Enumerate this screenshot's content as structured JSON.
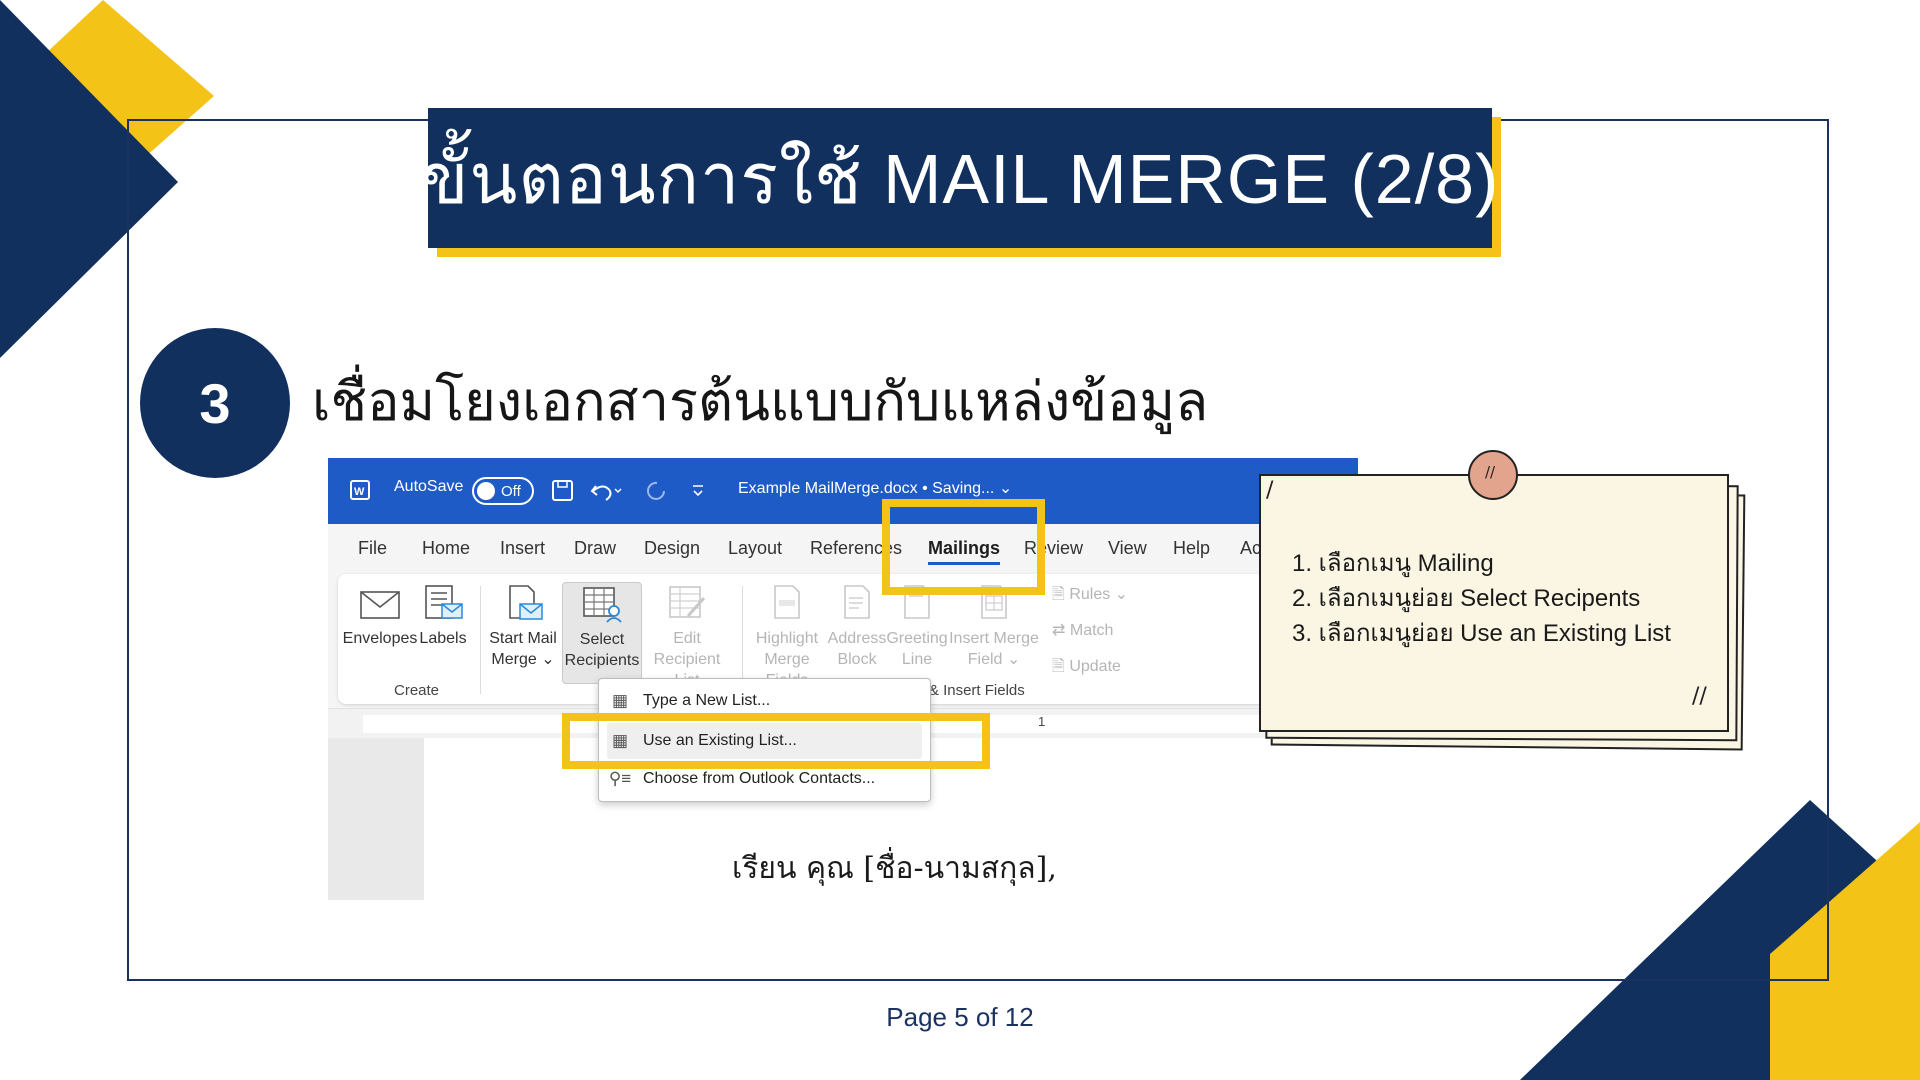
{
  "slide": {
    "title": "ขั้นตอนการใช้ MAIL MERGE (2/8)",
    "step_number": "3",
    "step_heading": "เชื่อมโยงเอกสารต้นแบบกับแหล่งข้อมูล",
    "page_indicator": "Page 5 of 12"
  },
  "colors": {
    "navy": "#12305e",
    "yellow": "#f3c317",
    "word_blue": "#1f5bc6",
    "note_bg": "#fbf6e4",
    "pin": "#e3a48d"
  },
  "word": {
    "titlebar": {
      "autosave_label": "AutoSave",
      "autosave_state": "Off",
      "doc_title": "Example MailMerge.docx • Saving... ⌄"
    },
    "tabs": [
      "File",
      "Home",
      "Insert",
      "Draw",
      "Design",
      "Layout",
      "References",
      "Mailings",
      "Review",
      "View",
      "Help",
      "Ac"
    ],
    "active_tab": "Mailings",
    "ribbon": {
      "envelopes": "Envelopes",
      "labels": "Labels",
      "start_mail_merge": [
        "Start Mail",
        "Merge ⌄"
      ],
      "select_recipients": [
        "Select",
        "Recipients ⌄"
      ],
      "edit_recipient_list": [
        "Edit",
        "Recipient List"
      ],
      "highlight_merge_fields": [
        "Highlight",
        "Merge Fields"
      ],
      "address_block": [
        "Address",
        "Block"
      ],
      "greeting_line": [
        "Greeting",
        "Line"
      ],
      "insert_merge_field": [
        "Insert Merge",
        "Field ⌄"
      ],
      "rules": "Rules ⌄",
      "match": "Match",
      "update": "Update",
      "group_create": "Create",
      "group_write_insert": "Write & Insert Fields"
    },
    "dropdown": [
      {
        "label": "Type a New List...",
        "icon": "table-icon"
      },
      {
        "label": "Use an Existing List...",
        "icon": "table-icon"
      },
      {
        "label": "Choose from Outlook Contacts...",
        "icon": "contacts-icon"
      }
    ],
    "ruler_mark": "1",
    "document_text": "เรียน คุณ [ชื่อ-นามสกุล],"
  },
  "note": {
    "items": [
      "1. เลือกเมนู Mailing",
      "2. เลือกเมนูย่อย Select Recipents",
      "3. เลือกเมนูย่อย Use an Existing List"
    ]
  }
}
